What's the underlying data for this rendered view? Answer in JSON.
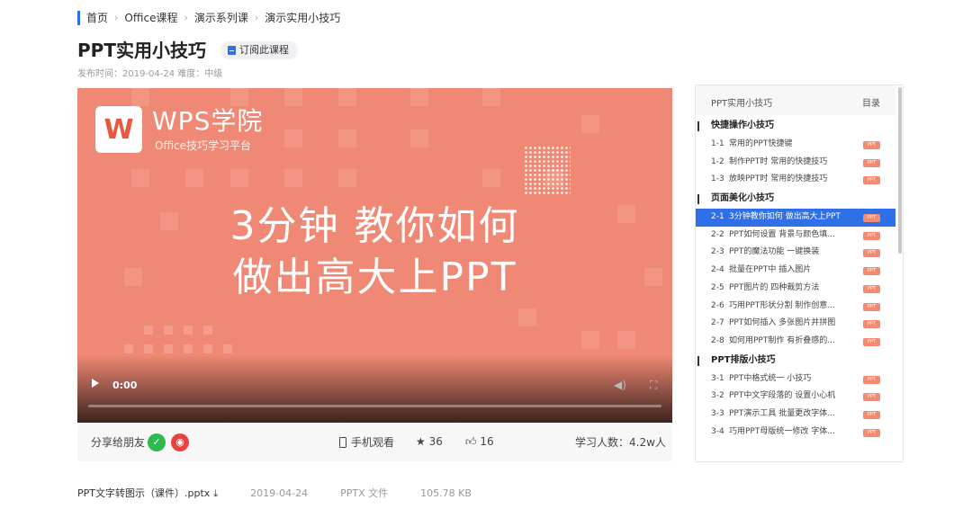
{
  "breadcrumb": {
    "items": [
      "首页",
      "Office课程",
      "演示系列课",
      "演示实用小技巧"
    ]
  },
  "page": {
    "title": "PPT实用小技巧",
    "subscribe_label": "订阅此课程",
    "meta": "发布时间：2019-04-24 难度：中级"
  },
  "video": {
    "logo_text": "WPS学院",
    "logo_sub": "Office技巧学习平台",
    "headline_1": "3分钟 教你如何",
    "headline_2": "做出高大上PPT",
    "time": "0:00",
    "progress": 0
  },
  "bottom_bar": {
    "share_label": "分享给朋友",
    "mobile_label": "手机观看",
    "stars": "★ 36",
    "likes": "16",
    "learners": "学习人数：4.2w人"
  },
  "sidebar": {
    "title": "PPT实用小技巧",
    "menu_label": "目录",
    "badge": "PPT",
    "sections": [
      {
        "title": "快捷操作小技巧",
        "items": [
          {
            "num": "1-1",
            "label": "常用的PPT快捷键"
          },
          {
            "num": "1-2",
            "label": "制作PPT时 常用的快捷技巧"
          },
          {
            "num": "1-3",
            "label": "放映PPT时 常用的快捷技巧"
          }
        ]
      },
      {
        "title": "页面美化小技巧",
        "items": [
          {
            "num": "2-1",
            "label": "3分钟教你如何 做出高大上PPT",
            "active": true
          },
          {
            "num": "2-2",
            "label": "PPT如何设置 背景与颜色填..."
          },
          {
            "num": "2-3",
            "label": "PPT的魔法功能 一键换装"
          },
          {
            "num": "2-4",
            "label": "批量在PPT中 插入图片"
          },
          {
            "num": "2-5",
            "label": "PPT图片的 四种裁剪方法"
          },
          {
            "num": "2-6",
            "label": "巧用PPT形状分割 制作创意..."
          },
          {
            "num": "2-7",
            "label": "PPT如何插入 多张图片并拼图"
          },
          {
            "num": "2-8",
            "label": "如何用PPT制作 有折叠感的..."
          }
        ]
      },
      {
        "title": "PPT排版小技巧",
        "items": [
          {
            "num": "3-1",
            "label": "PPT中格式统一 小技巧"
          },
          {
            "num": "3-2",
            "label": "PPT中文字段落的 设置小心机"
          },
          {
            "num": "3-3",
            "label": "PPT演示工具 批量更改字体..."
          },
          {
            "num": "3-4",
            "label": "巧用PPT母版统一修改 字体..."
          }
        ]
      }
    ]
  },
  "file": {
    "name": "PPT文字转图示（课件）.pptx",
    "date": "2019-04-24",
    "type": "PPTX 文件",
    "size": "105.78 KB"
  },
  "colors": {
    "accent": "#2f6fe8",
    "video_bg": "#ef8874",
    "badge": "#f58a72"
  }
}
